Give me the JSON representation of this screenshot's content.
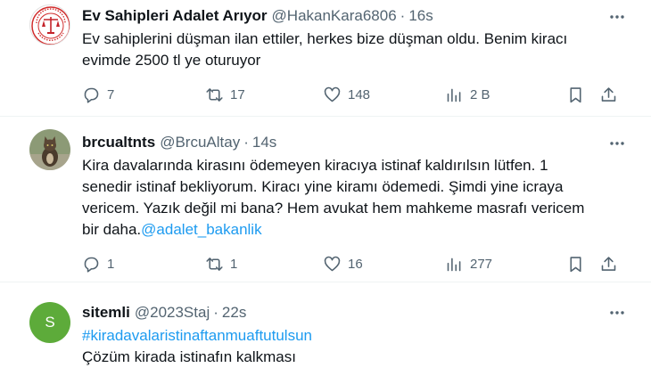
{
  "tweets": [
    {
      "name": "Ev Sahipleri Adalet Arıyor",
      "handle": "@HakanKara6806",
      "time": "16s",
      "lines": [
        "Ev sahiplerini düşman ilan ettiler, herkes bize düşman oldu. Benim kiracı",
        "evimde 2500 tl ye oturuyor"
      ],
      "avatar_text": "ADALET ARIYOR",
      "replies": "7",
      "retweets": "17",
      "likes": "148",
      "views": "2 B"
    },
    {
      "name": "brcualtnts",
      "handle": "@BrcuAltay",
      "time": "14s",
      "lines": [
        "Kira davalarında kirasını ödemeyen kiracıya istinaf kaldırılsın lütfen. 1",
        "senedir istinaf bekliyorum. Kiracı yine kiramı ödemedi. Şimdi yine icraya",
        "vericem. Yazık değil mi bana? Hem avukat hem mahkeme masrafı vericem"
      ],
      "last_line_text": "bir daha.",
      "mention": "@adalet_bakanlik",
      "replies": "1",
      "retweets": "1",
      "likes": "16",
      "views": "277"
    },
    {
      "name": "sitemli",
      "handle": "@2023Staj",
      "time": "22s",
      "avatar_letter": "S",
      "hashtag": "#kiradavalaristinaftanmuaftutulsun",
      "line": "Çözüm kirada istinafın kalkması"
    }
  ],
  "separator": "·",
  "icons": [
    "reply-icon",
    "retweet-icon",
    "like-icon",
    "views-icon",
    "bookmark-icon",
    "share-icon",
    "more-icon"
  ],
  "colors": {
    "link": "#1d9bf0",
    "secondary_text": "#536471",
    "avatar_green": "#5dab3a",
    "divider": "#eff3f4"
  }
}
